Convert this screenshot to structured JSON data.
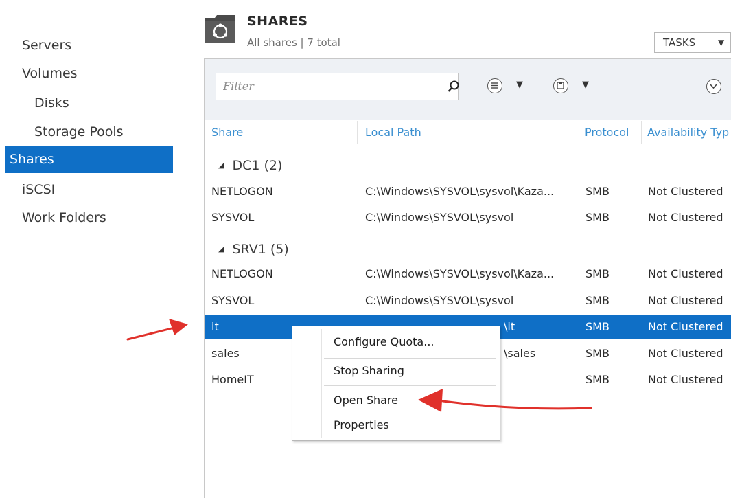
{
  "sidebar": {
    "items": [
      {
        "label": "Servers"
      },
      {
        "label": "Volumes"
      },
      {
        "label": "Disks"
      },
      {
        "label": "Storage Pools"
      },
      {
        "label": "Shares"
      },
      {
        "label": "iSCSI"
      },
      {
        "label": "Work Folders"
      }
    ]
  },
  "header": {
    "title": "SHARES",
    "subtitle": "All shares | 7 total",
    "tasks_label": "TASKS"
  },
  "toolbar": {
    "filter_placeholder": "Filter"
  },
  "table": {
    "columns": [
      "Share",
      "Local Path",
      "Protocol",
      "Availability Typ"
    ],
    "groups": [
      {
        "label": "DC1 (2)"
      },
      {
        "label": "SRV1 (5)"
      }
    ],
    "rows": [
      {
        "share": "NETLOGON",
        "path": "C:\\Windows\\SYSVOL\\sysvol\\Kaza...",
        "protocol": "SMB",
        "availability": "Not Clustered"
      },
      {
        "share": "SYSVOL",
        "path": "C:\\Windows\\SYSVOL\\sysvol",
        "protocol": "SMB",
        "availability": "Not Clustered"
      },
      {
        "share": "NETLOGON",
        "path": "C:\\Windows\\SYSVOL\\sysvol\\Kaza...",
        "protocol": "SMB",
        "availability": "Not Clustered"
      },
      {
        "share": "SYSVOL",
        "path": "C:\\Windows\\SYSVOL\\sysvol",
        "protocol": "SMB",
        "availability": "Not Clustered"
      },
      {
        "share": "it",
        "path": "\\it",
        "protocol": "SMB",
        "availability": "Not Clustered"
      },
      {
        "share": "sales",
        "path": "\\sales",
        "protocol": "SMB",
        "availability": "Not Clustered"
      },
      {
        "share": "HomeIT",
        "path": "",
        "protocol": "SMB",
        "availability": "Not Clustered"
      }
    ]
  },
  "context_menu": {
    "items": [
      {
        "label": "Configure Quota..."
      },
      {
        "label": "Stop Sharing"
      },
      {
        "label": "Open Share"
      },
      {
        "label": "Properties"
      }
    ]
  },
  "colors": {
    "accent": "#0f6fc6",
    "column_header": "#3a8fd0",
    "annotation_arrow": "#e0312b"
  }
}
